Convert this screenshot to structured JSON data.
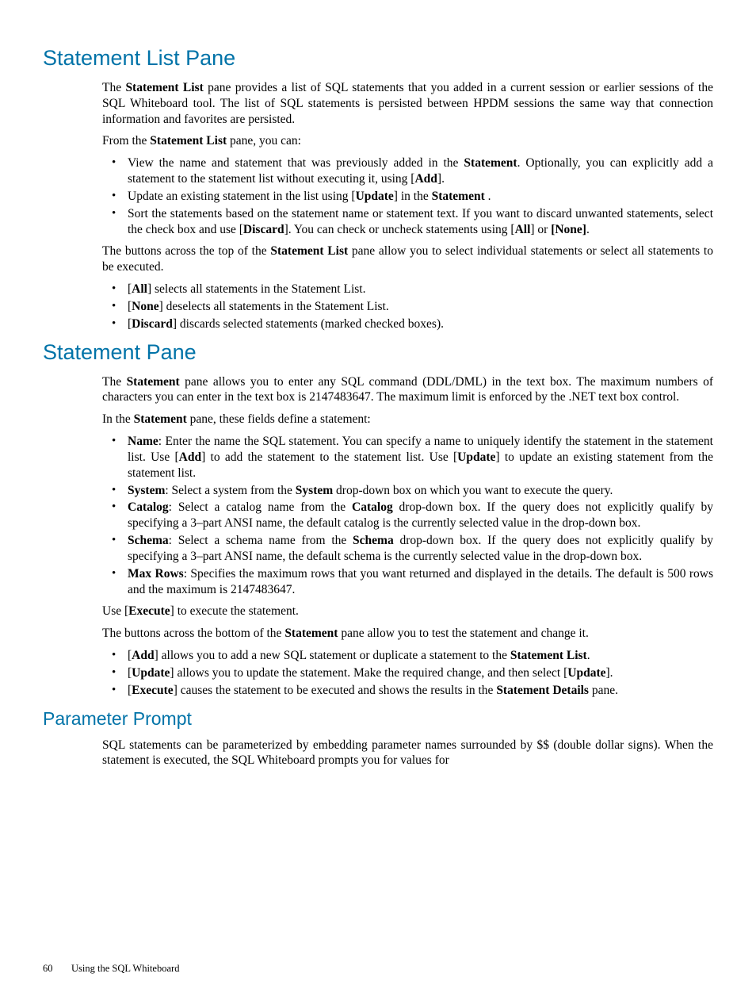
{
  "section1": {
    "title": "Statement List Pane",
    "p1_a": "The ",
    "p1_b": "Statement List",
    "p1_c": " pane provides a list of SQL statements that you added in a current session or earlier sessions of the SQL Whiteboard tool. The list of SQL statements is persisted between HPDM sessions the same way that connection information and favorites are persisted.",
    "p2_a": "From the ",
    "p2_b": "Statement List",
    "p2_c": " pane, you can:",
    "b1_a": "View the name and statement that was previously added in the ",
    "b1_b": "Statement",
    "b1_c": ". Optionally, you can explicitly add a statement to the statement list without executing it, using [",
    "b1_d": "Add",
    "b1_e": "].",
    "b2_a": "Update an existing statement in the list using [",
    "b2_b": "Update",
    "b2_c": "] in the ",
    "b2_d": "Statement",
    "b2_e": " .",
    "b3_a": "Sort the statements based on the statement name or statement text. If you want to discard unwanted statements, select the check box and use [",
    "b3_b": "Discard",
    "b3_c": "]. You can check or uncheck statements using [",
    "b3_d": "All",
    "b3_e": "] or ",
    "b3_f": "[None]",
    "b3_g": ".",
    "p3_a": "The buttons across the top of the ",
    "p3_b": "Statement List",
    "p3_c": " pane allow you to select individual statements or select all statements to be executed.",
    "b4_a": "[",
    "b4_b": "All",
    "b4_c": "] selects all statements in the Statement List.",
    "b5_a": "[",
    "b5_b": "None",
    "b5_c": "] deselects all statements in the Statement List.",
    "b6_a": "[",
    "b6_b": "Discard",
    "b6_c": "] discards selected statements (marked checked boxes)."
  },
  "section2": {
    "title": "Statement Pane",
    "p1_a": "The ",
    "p1_b": "Statement",
    "p1_c": " pane allows you to enter any SQL command (DDL/DML) in the text box. The maximum numbers of characters you can enter in the text box is 2147483647. The maximum limit is enforced by the .NET text box control.",
    "p2_a": "In the ",
    "p2_b": "Statement",
    "p2_c": " pane, these fields define a statement:",
    "b1_a": "Name",
    "b1_b": ": Enter the name the SQL statement. You can specify a name to uniquely identify the statement in the statement list. Use [",
    "b1_c": "Add",
    "b1_d": "] to add the statement to the statement list. Use [",
    "b1_e": "Update",
    "b1_f": "] to update an existing statement from the statement list.",
    "b2_a": "System",
    "b2_b": ": Select a system from the ",
    "b2_c": "System",
    "b2_d": " drop-down box on which you want to execute the query.",
    "b3_a": "Catalog",
    "b3_b": ": Select a catalog name from the ",
    "b3_c": "Catalog",
    "b3_d": " drop-down box. If the query does not explicitly qualify by specifying a 3–part ANSI name, the default catalog is the currently selected value in the drop-down box.",
    "b4_a": "Schema",
    "b4_b": ": Select a schema name from the ",
    "b4_c": "Schema",
    "b4_d": " drop-down box. If the query does not explicitly qualify by specifying a 3–part ANSI name, the default schema is the currently selected value in the drop-down box.",
    "b5_a": "Max Rows",
    "b5_b": ": Specifies the maximum rows that you want returned and displayed in the details. The default is 500 rows and the maximum is 2147483647.",
    "p3_a": "Use [",
    "p3_b": "Execute",
    "p3_c": "] to execute the statement.",
    "p4_a": "The buttons across the bottom of the ",
    "p4_b": "Statement",
    "p4_c": " pane allow you to test the statement and change it.",
    "b6_a": "[",
    "b6_b": "Add",
    "b6_c": "] allows you to add a new SQL statement or duplicate a statement to the ",
    "b6_d": "Statement List",
    "b6_e": ".",
    "b7_a": "[",
    "b7_b": "Update",
    "b7_c": "] allows you to update the statement. Make the required change, and then select [",
    "b7_d": "Update",
    "b7_e": "].",
    "b8_a": "[",
    "b8_b": "Execute",
    "b8_c": "] causes the statement to be executed and shows the results in the ",
    "b8_d": "Statement Details",
    "b8_e": " pane."
  },
  "section3": {
    "title": "Parameter Prompt",
    "p1": "SQL statements can be parameterized by embedding parameter names surrounded by $$ (double dollar signs). When the statement is executed, the SQL Whiteboard prompts you for values for"
  },
  "footer": {
    "page": "60",
    "chapter": "Using the SQL Whiteboard"
  }
}
